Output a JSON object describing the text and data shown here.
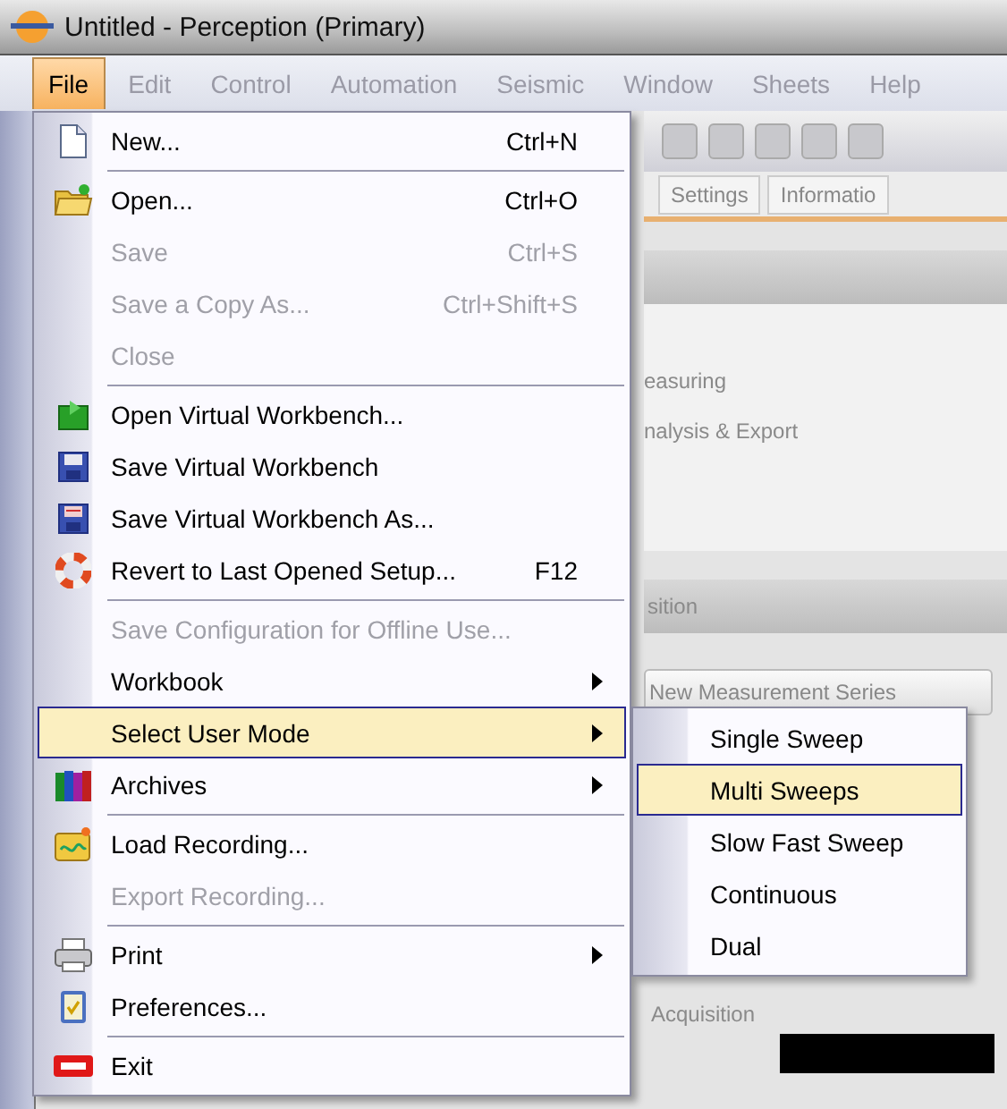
{
  "window": {
    "title": "Untitled - Perception (Primary)"
  },
  "menu_bar": [
    {
      "label": "File",
      "selected": true
    },
    {
      "label": "Edit",
      "selected": false
    },
    {
      "label": "Control",
      "selected": false
    },
    {
      "label": "Automation",
      "selected": false
    },
    {
      "label": "Seismic",
      "selected": false
    },
    {
      "label": "Window",
      "selected": false
    },
    {
      "label": "Sheets",
      "selected": false
    },
    {
      "label": "Help",
      "selected": false
    }
  ],
  "background": {
    "tabs": [
      "Settings",
      "Informatio"
    ],
    "panel_lines": [
      "easuring",
      "nalysis & Export"
    ],
    "section_title": "sition",
    "button": "New Measurement Series",
    "group_label": "Acquisition"
  },
  "file_menu": {
    "items": [
      {
        "label": "New...",
        "shortcut": "Ctrl+N",
        "disabled": false,
        "selected": false,
        "submenu": false,
        "separator_before": false
      },
      {
        "label": "Open...",
        "shortcut": "Ctrl+O",
        "disabled": false,
        "selected": false,
        "submenu": false,
        "separator_before": true
      },
      {
        "label": "Save",
        "shortcut": "Ctrl+S",
        "disabled": true,
        "selected": false,
        "submenu": false,
        "separator_before": false
      },
      {
        "label": "Save a Copy As...",
        "shortcut": "Ctrl+Shift+S",
        "disabled": true,
        "selected": false,
        "submenu": false,
        "separator_before": false
      },
      {
        "label": "Close",
        "disabled": true,
        "selected": false,
        "submenu": false,
        "separator_before": false
      },
      {
        "label": "Open Virtual Workbench...",
        "disabled": false,
        "selected": false,
        "submenu": false,
        "separator_before": true
      },
      {
        "label": "Save Virtual Workbench",
        "disabled": false,
        "selected": false,
        "submenu": false,
        "separator_before": false
      },
      {
        "label": "Save Virtual Workbench As...",
        "disabled": false,
        "selected": false,
        "submenu": false,
        "separator_before": false
      },
      {
        "label": "Revert to Last Opened Setup...",
        "shortcut": "F12",
        "disabled": false,
        "selected": false,
        "submenu": false,
        "separator_before": false
      },
      {
        "label": "Save Configuration for Offline Use...",
        "disabled": true,
        "selected": false,
        "submenu": false,
        "separator_before": true
      },
      {
        "label": "Workbook",
        "disabled": false,
        "selected": false,
        "submenu": true,
        "separator_before": false
      },
      {
        "label": "Select User Mode",
        "disabled": false,
        "selected": true,
        "submenu": true,
        "separator_before": false
      },
      {
        "label": "Archives",
        "disabled": false,
        "selected": false,
        "submenu": true,
        "separator_before": false
      },
      {
        "label": "Load Recording...",
        "disabled": false,
        "selected": false,
        "submenu": false,
        "separator_before": true
      },
      {
        "label": "Export Recording...",
        "disabled": true,
        "selected": false,
        "submenu": false,
        "separator_before": false
      },
      {
        "label": "Print",
        "disabled": false,
        "selected": false,
        "submenu": true,
        "separator_before": true
      },
      {
        "label": "Preferences...",
        "disabled": false,
        "selected": false,
        "submenu": false,
        "separator_before": false
      },
      {
        "label": "Exit",
        "disabled": false,
        "selected": false,
        "submenu": false,
        "separator_before": true
      }
    ]
  },
  "user_mode_menu": {
    "items": [
      {
        "label": "Single Sweep",
        "selected": false
      },
      {
        "label": "Multi Sweeps",
        "selected": true
      },
      {
        "label": "Slow Fast Sweep",
        "selected": false
      },
      {
        "label": "Continuous",
        "selected": false
      },
      {
        "label": "Dual",
        "selected": false
      }
    ]
  }
}
